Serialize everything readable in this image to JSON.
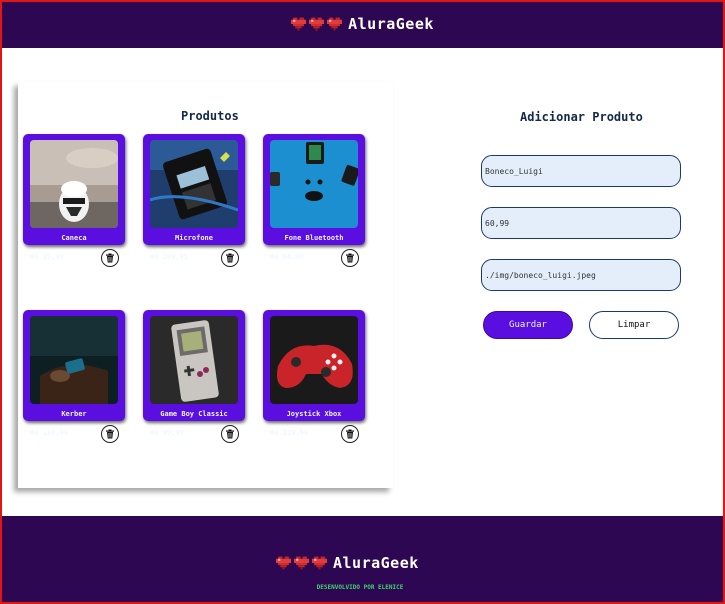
{
  "header": {
    "brand": "AluraGeek"
  },
  "products": {
    "title": "Produtos",
    "items": [
      {
        "name": "Caneca",
        "price": "R$ 39,99"
      },
      {
        "name": "Microfone",
        "price": "R$ 109,95"
      },
      {
        "name": "Fone Bluetooth",
        "price": "R$ 84,90"
      },
      {
        "name": "Kerber",
        "price": "R$ 134,99"
      },
      {
        "name": "Game Boy Classic",
        "price": "R$ 99,99"
      },
      {
        "name": "Joystick Xbox",
        "price": "R$ 219,99"
      }
    ]
  },
  "form": {
    "title": "Adicionar Produto",
    "name_value": "Boneco_Luigi",
    "price_value": "60,99",
    "image_value": "./img/boneco_luigi.jpeg",
    "save_label": "Guardar",
    "clear_label": "Limpar"
  },
  "footer": {
    "brand": "AluraGeek",
    "credit": "DESENVOLVIDO POR ELENICE"
  },
  "colors": {
    "header_bg": "#2e0753",
    "card_bg": "#5a0fe0",
    "accent_green": "#3fd46a",
    "input_bg": "#e4eefb"
  },
  "icons": {
    "logo": "pixel-heart-icon",
    "delete": "trash-icon"
  }
}
